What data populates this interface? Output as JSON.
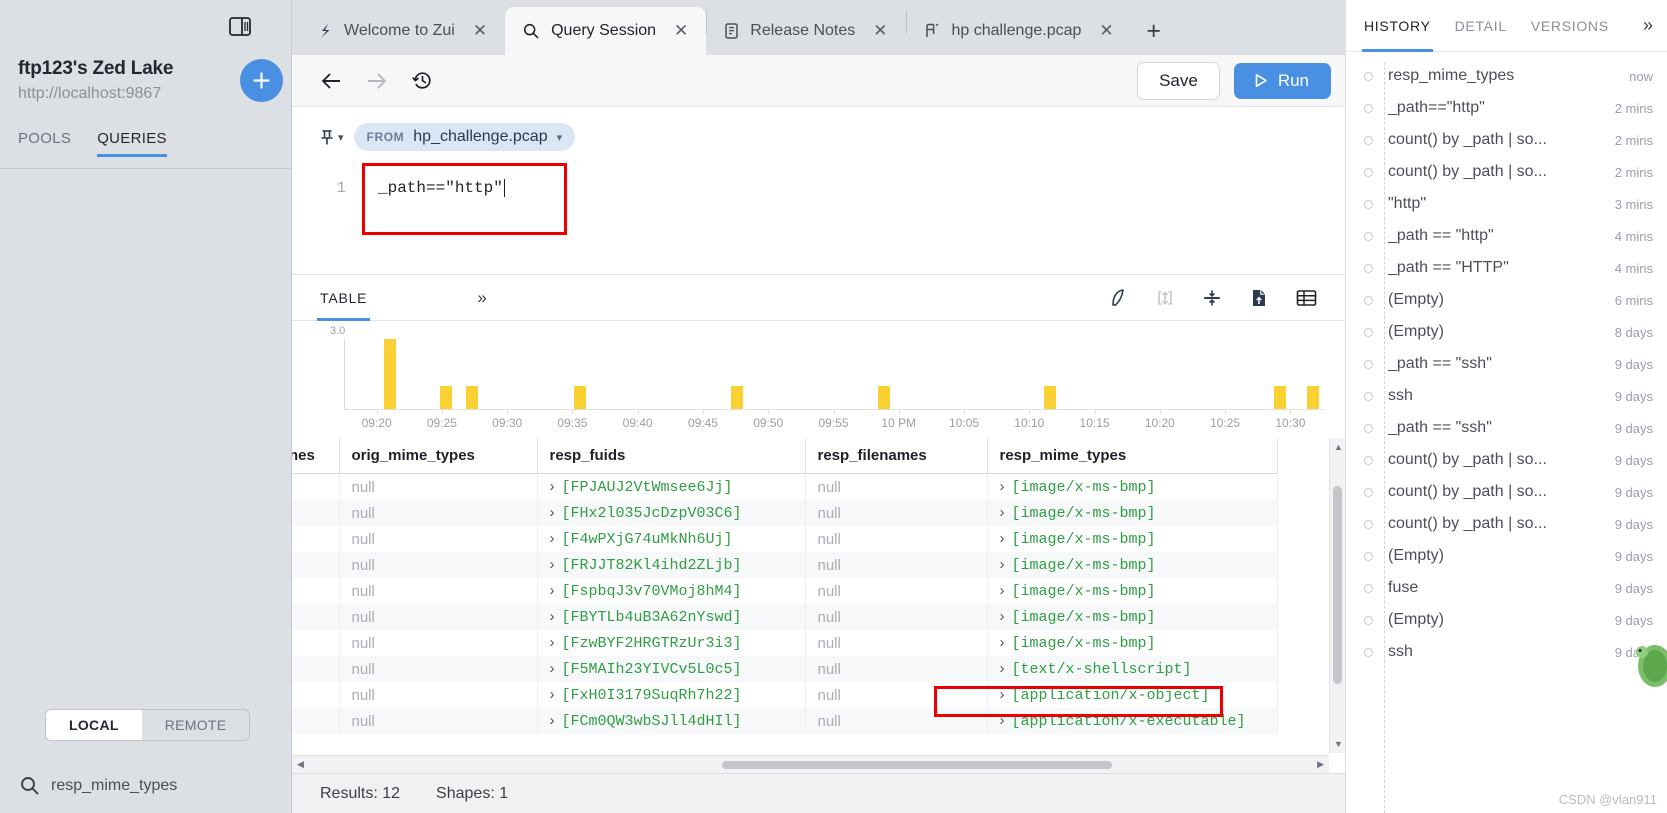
{
  "sidebar": {
    "lake_title": "ftp123's Zed Lake",
    "lake_url": "http://localhost:9867",
    "add_button_label": "+",
    "tabs": [
      {
        "label": "POOLS",
        "active": false
      },
      {
        "label": "QUERIES",
        "active": true
      }
    ],
    "local_remote": [
      {
        "label": "LOCAL",
        "active": true
      },
      {
        "label": "REMOTE",
        "active": false
      }
    ],
    "search_value": "resp_mime_types"
  },
  "tabbar": {
    "tabs": [
      {
        "label": "Welcome to Zui",
        "icon": "zui-logo-icon",
        "active": false,
        "close": "✕"
      },
      {
        "label": "Query Session",
        "icon": "search-icon",
        "active": true,
        "close": "✕"
      },
      {
        "label": "Release Notes",
        "icon": "document-icon",
        "active": false,
        "close": "✕"
      },
      {
        "label": "hp challenge.pcap",
        "icon": "pcap-icon",
        "active": false,
        "close": "✕"
      }
    ],
    "new_tab_label": "+"
  },
  "toolbar": {
    "back_icon": "arrow-left-icon",
    "forward_icon": "arrow-right-icon",
    "history_icon": "clock-history-icon",
    "save_label": "Save",
    "run_label": "Run"
  },
  "editor": {
    "pin_icon": "pin-icon",
    "from_keyword": "FROM",
    "from_value": "hp_challenge.pcap",
    "line_number": "1",
    "query_text": "_path==\"http\""
  },
  "results": {
    "tab_label": "TABLE",
    "expand_icon": "chevron-double-right-icon",
    "icons": [
      "shark-fin-icon",
      "expand-vertical-icon",
      "collapse-vertical-icon",
      "export-file-icon",
      "table-grid-icon"
    ]
  },
  "chart_data": {
    "type": "bar",
    "title": "",
    "xlabel": "",
    "ylabel": "",
    "ylim": [
      0,
      3.0
    ],
    "y_tick_labels": [
      "3.0"
    ],
    "x_tick_labels": [
      "09:20",
      "09:25",
      "09:30",
      "09:35",
      "09:40",
      "09:45",
      "09:50",
      "09:55",
      "10 PM",
      "10:05",
      "10:10",
      "10:15",
      "10:20",
      "10:25",
      "10:30"
    ],
    "bar_color": "#fad033",
    "grid": false,
    "legend": false,
    "categories": [
      "09:20",
      "09:21",
      "09:22",
      "09:23",
      "09:24",
      "09:25",
      "09:26",
      "09:27",
      "09:28",
      "09:29",
      "09:30",
      "09:31",
      "09:32",
      "09:33",
      "09:34",
      "09:35",
      "09:36",
      "09:37",
      "09:38",
      "09:39",
      "09:40",
      "09:41",
      "09:42",
      "09:43",
      "09:44",
      "09:45",
      "09:46",
      "09:47",
      "09:48",
      "09:49",
      "09:50",
      "09:51",
      "09:52",
      "09:53",
      "09:54",
      "09:55",
      "09:56",
      "09:57",
      "09:58",
      "09:59",
      "10 PM",
      "10:01",
      "10:02",
      "10:03",
      "10:04",
      "10:05",
      "10:06",
      "10:07",
      "10:08",
      "10:09",
      "10:10",
      "10:11",
      "10:12",
      "10:13",
      "10:14",
      "10:15",
      "10:16",
      "10:17",
      "10:18",
      "10:19",
      "10:20",
      "10:21",
      "10:22",
      "10:23",
      "10:24",
      "10:25",
      "10:26",
      "10:27",
      "10:28",
      "10:29",
      "10:30"
    ],
    "values": [
      3,
      0,
      0,
      0,
      0,
      1,
      0,
      1,
      0,
      0,
      0,
      0,
      0,
      0,
      0,
      0,
      1,
      0,
      0,
      0,
      0,
      0,
      0,
      0,
      0,
      0,
      1,
      0,
      0,
      0,
      0,
      0,
      0,
      0,
      0,
      0,
      1,
      0,
      0,
      0,
      0,
      0,
      0,
      0,
      0,
      0,
      0,
      0,
      1,
      0,
      0,
      0,
      0,
      0,
      0,
      0,
      0,
      0,
      0,
      0,
      0,
      0,
      0,
      0,
      0,
      0,
      1,
      0,
      0,
      1,
      0
    ],
    "bars": [
      {
        "x_pct": 4.0,
        "value": 3
      },
      {
        "x_pct": 9.7,
        "value": 1
      },
      {
        "x_pct": 12.4,
        "value": 1
      },
      {
        "x_pct": 23.4,
        "value": 1
      },
      {
        "x_pct": 39.5,
        "value": 1
      },
      {
        "x_pct": 54.5,
        "value": 1
      },
      {
        "x_pct": 71.5,
        "value": 1
      },
      {
        "x_pct": 95.0,
        "value": 1
      },
      {
        "x_pct": 98.4,
        "value": 1
      }
    ]
  },
  "table": {
    "columns": [
      "nes",
      "orig_mime_types",
      "resp_fuids",
      "resp_filenames",
      "resp_mime_types"
    ],
    "rows": [
      {
        "nes": "",
        "orig_mime_types": "null",
        "resp_fuids": "[FPJAUJ2VtWmsee6Jj]",
        "resp_filenames": "null",
        "resp_mime_types": "[image/x-ms-bmp]"
      },
      {
        "nes": "",
        "orig_mime_types": "null",
        "resp_fuids": "[FHx2l035JcDzpV03C6]",
        "resp_filenames": "null",
        "resp_mime_types": "[image/x-ms-bmp]"
      },
      {
        "nes": "",
        "orig_mime_types": "null",
        "resp_fuids": "[F4wPXjG74uMkNh6Uj]",
        "resp_filenames": "null",
        "resp_mime_types": "[image/x-ms-bmp]"
      },
      {
        "nes": "",
        "orig_mime_types": "null",
        "resp_fuids": "[FRJJT82Kl4ihd2ZLjb]",
        "resp_filenames": "null",
        "resp_mime_types": "[image/x-ms-bmp]"
      },
      {
        "nes": "",
        "orig_mime_types": "null",
        "resp_fuids": "[FspbqJ3v70VMoj8hM4]",
        "resp_filenames": "null",
        "resp_mime_types": "[image/x-ms-bmp]"
      },
      {
        "nes": "",
        "orig_mime_types": "null",
        "resp_fuids": "[FBYTLb4uB3A62nYswd]",
        "resp_filenames": "null",
        "resp_mime_types": "[image/x-ms-bmp]"
      },
      {
        "nes": "",
        "orig_mime_types": "null",
        "resp_fuids": "[FzwBYF2HRGTRzUr3i3]",
        "resp_filenames": "null",
        "resp_mime_types": "[image/x-ms-bmp]"
      },
      {
        "nes": "",
        "orig_mime_types": "null",
        "resp_fuids": "[F5MAIh23YIVCv5L0c5]",
        "resp_filenames": "null",
        "resp_mime_types": "[text/x-shellscript]"
      },
      {
        "nes": "",
        "orig_mime_types": "null",
        "resp_fuids": "[FxH0I3179SuqRh7h22]",
        "resp_filenames": "null",
        "resp_mime_types": "[application/x-object]"
      },
      {
        "nes": "",
        "orig_mime_types": "null",
        "resp_fuids": "[FCm0QW3wbSJll4dHIl]",
        "resp_filenames": "null",
        "resp_mime_types": "[application/x-executable]"
      }
    ]
  },
  "statusbar": {
    "results_label": "Results: 12",
    "shapes_label": "Shapes: 1"
  },
  "history": {
    "tabs": [
      {
        "label": "HISTORY",
        "active": true
      },
      {
        "label": "DETAIL",
        "active": false
      },
      {
        "label": "VERSIONS",
        "active": false
      }
    ],
    "more_icon": "chevron-double-right-icon",
    "items": [
      {
        "label": "resp_mime_types",
        "time": "now"
      },
      {
        "label": "_path==\"http\"",
        "time": "2 mins"
      },
      {
        "label": "count() by _path | so...",
        "time": "2 mins"
      },
      {
        "label": "count() by _path | so...",
        "time": "2 mins"
      },
      {
        "label": "\"http\"",
        "time": "3 mins"
      },
      {
        "label": "_path == \"http\"",
        "time": "4 mins"
      },
      {
        "label": "_path == \"HTTP\"",
        "time": "4 mins"
      },
      {
        "label": "(Empty)",
        "time": "6 mins"
      },
      {
        "label": "(Empty)",
        "time": "8 days"
      },
      {
        "label": "_path == \"ssh\"",
        "time": "9 days"
      },
      {
        "label": "ssh",
        "time": "9 days"
      },
      {
        "label": "_path == \"ssh\"",
        "time": "9 days"
      },
      {
        "label": "count() by _path | so...",
        "time": "9 days"
      },
      {
        "label": "count() by _path | so...",
        "time": "9 days"
      },
      {
        "label": "count() by _path | so...",
        "time": "9 days"
      },
      {
        "label": "(Empty)",
        "time": "9 days"
      },
      {
        "label": "fuse",
        "time": "9 days"
      },
      {
        "label": "(Empty)",
        "time": "9 days"
      },
      {
        "label": "ssh",
        "time": "9 days"
      }
    ]
  },
  "watermark": "CSDN @vlan911",
  "colors": {
    "accent": "#4a90e2",
    "bar": "#fad033",
    "highlight": "#ee0000",
    "sidebar_bg": "#dcdfe3",
    "value_green": "#2f9e44"
  }
}
